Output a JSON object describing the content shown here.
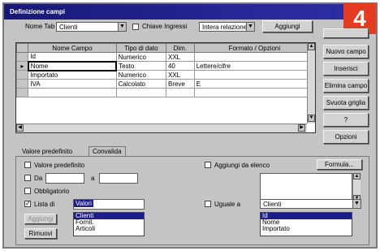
{
  "window": {
    "title": "Definizione campi"
  },
  "badge": "4",
  "top": {
    "nome_tab_label": "Nome Tab",
    "nome_tab_value": "Clienti",
    "chiave_label": "Chiave Ingressi",
    "chiave_value": "Intera relazione",
    "aggiungi_label": "Aggiungi"
  },
  "grid": {
    "headers": [
      "Nome Campo",
      "Tipo di dato",
      "Dim.",
      "Formato / Opzioni"
    ],
    "rows": [
      {
        "marker": "",
        "cells": [
          "Id",
          "Numerico",
          "XXL",
          ""
        ]
      },
      {
        "marker": "▸",
        "cells": [
          "Nome",
          "Testo",
          "40",
          "Lettere/cifre"
        ]
      },
      {
        "marker": "",
        "cells": [
          "Importato",
          "Numerico",
          "XXL",
          ""
        ]
      },
      {
        "marker": "",
        "cells": [
          "IVA",
          "Calcolato",
          "Breve",
          "E"
        ]
      },
      {
        "marker": "",
        "cells": [
          "",
          "",
          "",
          ""
        ]
      }
    ]
  },
  "side_buttons": [
    {
      "label": "",
      "enabled": true
    },
    {
      "label": "Nuovo campo",
      "enabled": true
    },
    {
      "label": "Inserisci",
      "enabled": true
    },
    {
      "label": "Elimina campo",
      "enabled": true
    },
    {
      "label": "Svuota griglia",
      "enabled": true
    },
    {
      "label": "?",
      "enabled": true
    },
    {
      "label": "Opzioni",
      "enabled": true
    }
  ],
  "tabs": {
    "t1": "Valore predefinito",
    "t2": "Convalida"
  },
  "panel": {
    "chk1": "Valore predefinito",
    "range_from": "Da",
    "range_to": "a",
    "chk_obbl": "Obbligatorio",
    "chk_lista": "Lista di",
    "lista_value": "Valori",
    "chk_unico": "Aggiungi da elenco",
    "formula_btn": "Formula...",
    "chk_uguale": "Uguale a",
    "uguale_value": "Clienti",
    "lista_items": [
      "Clienti",
      "Fornit.",
      "Articoli"
    ],
    "uguale_items": [
      "Id",
      "Nome",
      "Importato"
    ],
    "btn1": "Aggiungi",
    "btn2": "Rimuovi"
  }
}
